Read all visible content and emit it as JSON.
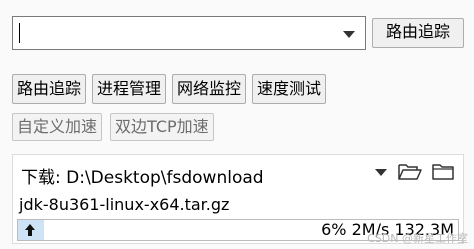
{
  "top": {
    "trace_label": "路由追踪"
  },
  "toolbar": {
    "row1": [
      "路由追踪",
      "进程管理",
      "网络监控",
      "速度测试"
    ],
    "row2": [
      "自定义加速",
      "双边TCP加速"
    ]
  },
  "download": {
    "label": "下载: D:\\Desktop\\fsdownload",
    "file_name": "jdk-8u361-linux-x64.tar.gz",
    "progress_percent": 6,
    "progress_text": "6% 2M/s 132.3M"
  },
  "watermark": "CSDN @新星工作室"
}
